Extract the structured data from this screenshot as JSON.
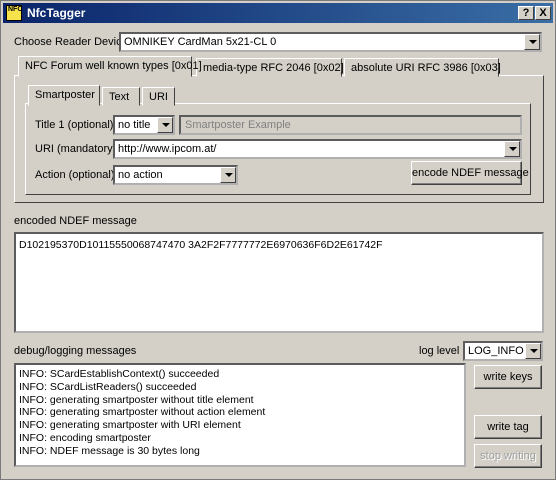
{
  "window": {
    "title": "NfcTagger",
    "icon_text": "NFC",
    "help_label": "?",
    "close_label": "X"
  },
  "reader": {
    "label": "Choose Reader Device",
    "value": "OMNIKEY CardMan 5x21-CL 0"
  },
  "tabs": [
    {
      "label": "NFC Forum well known types [0x01]"
    },
    {
      "label": "media-type RFC 2046 [0x02]"
    },
    {
      "label": "absolute URI RFC 3986 [0x03]"
    }
  ],
  "subtabs": [
    {
      "label": "Smartposter"
    },
    {
      "label": "Text"
    },
    {
      "label": "URI"
    }
  ],
  "smartposter": {
    "title_label": "Title 1 (optional)",
    "title_mode": "no title",
    "title_placeholder": "Smartposter Example",
    "uri_label": "URI (mandatory)",
    "uri_value": "http://www.ipcom.at/",
    "action_label": "Action (optional)",
    "action_value": "no action",
    "encode_button": "encode NDEF message"
  },
  "encoded": {
    "label": "encoded NDEF message",
    "value": "D102195370D10115550068747470 3A2F2F7777772E6970636F6D2E61742F"
  },
  "debug": {
    "label": "debug/logging messages",
    "log_level_label": "log level",
    "log_level_value": "LOG_INFO",
    "lines": [
      "INFO: SCardEstablishContext() succeeded",
      "INFO: SCardListReaders() succeeded",
      "INFO: generating smartposter without title element",
      "INFO: generating smartposter without action element",
      "INFO: generating smartposter with URI element",
      "INFO: encoding smartposter",
      "INFO: NDEF message is 30 bytes long"
    ]
  },
  "buttons": {
    "write_keys": "write keys",
    "write_tag": "write tag",
    "stop_writing": "stop writing"
  }
}
